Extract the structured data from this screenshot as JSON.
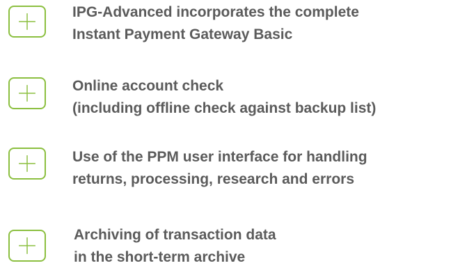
{
  "accent_color": "#8bbf3f",
  "text_color": "#5b5b5b",
  "icon": "plus-icon",
  "features": [
    {
      "line1": "IPG-Advanced incorporates the complete",
      "line2": "Instant Payment Gateway Basic"
    },
    {
      "line1": "Online account check",
      "line2": "(including offline check against backup list)"
    },
    {
      "line1": "Use of the PPM user interface for handling",
      "line2": "returns, processing, research and errors"
    },
    {
      "line1": "Archiving of transaction data",
      "line2": "in the short-term archive"
    }
  ]
}
